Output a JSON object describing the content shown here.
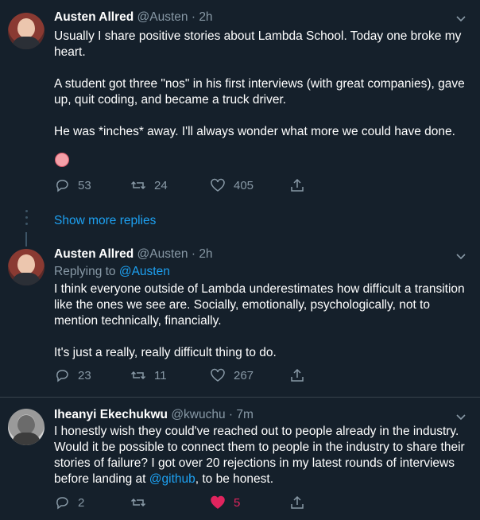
{
  "tweets": [
    {
      "name": "Austen Allred",
      "handle": "@Austen",
      "dot": "·",
      "time": "2h",
      "replying_label": "",
      "replying_to": "",
      "body": [
        "Usually I share positive stories about Lambda School. Today one broke my heart.",
        "A student got three \"nos\" in his first interviews (with great companies), gave up, quit coding, and became a truck driver.",
        "He was *inches* away. I'll always wonder what more we could have done."
      ],
      "replies": "53",
      "retweets": "24",
      "likes": "405"
    },
    {
      "name": "Austen Allred",
      "handle": "@Austen",
      "dot": "·",
      "time": "2h",
      "replying_label": "Replying to",
      "replying_to": "@Austen",
      "body": [
        "I think everyone outside of Lambda underestimates how difficult a transition like the ones we see are. Socially, emotionally, psychologically, not to mention technically, financially.",
        "It's just a really, really difficult thing to do."
      ],
      "replies": "23",
      "retweets": "11",
      "likes": "267"
    },
    {
      "name": "Iheanyi Ekechukwu",
      "handle": "@kwuchu",
      "dot": "·",
      "time": "7m",
      "body_before": "I honestly wish they could've reached out to people already in the industry. Would it be possible to connect them to people in the industry to share their stories of failure? I got over 20 rejections in my latest rounds of interviews before landing at ",
      "mention": "@github",
      "body_after": ", to be honest.",
      "replies": "2",
      "retweets": "",
      "likes": "5"
    }
  ],
  "show_more": "Show more replies",
  "colors": {
    "background": "#15202b",
    "text": "#ffffff",
    "muted": "#8899a6",
    "link": "#1da1f2",
    "like": "#e0245e",
    "divider": "#38444d"
  },
  "icons": [
    "chevron-down-icon",
    "reply-icon",
    "retweet-icon",
    "like-icon",
    "share-icon",
    "pouting-face-emoji"
  ]
}
